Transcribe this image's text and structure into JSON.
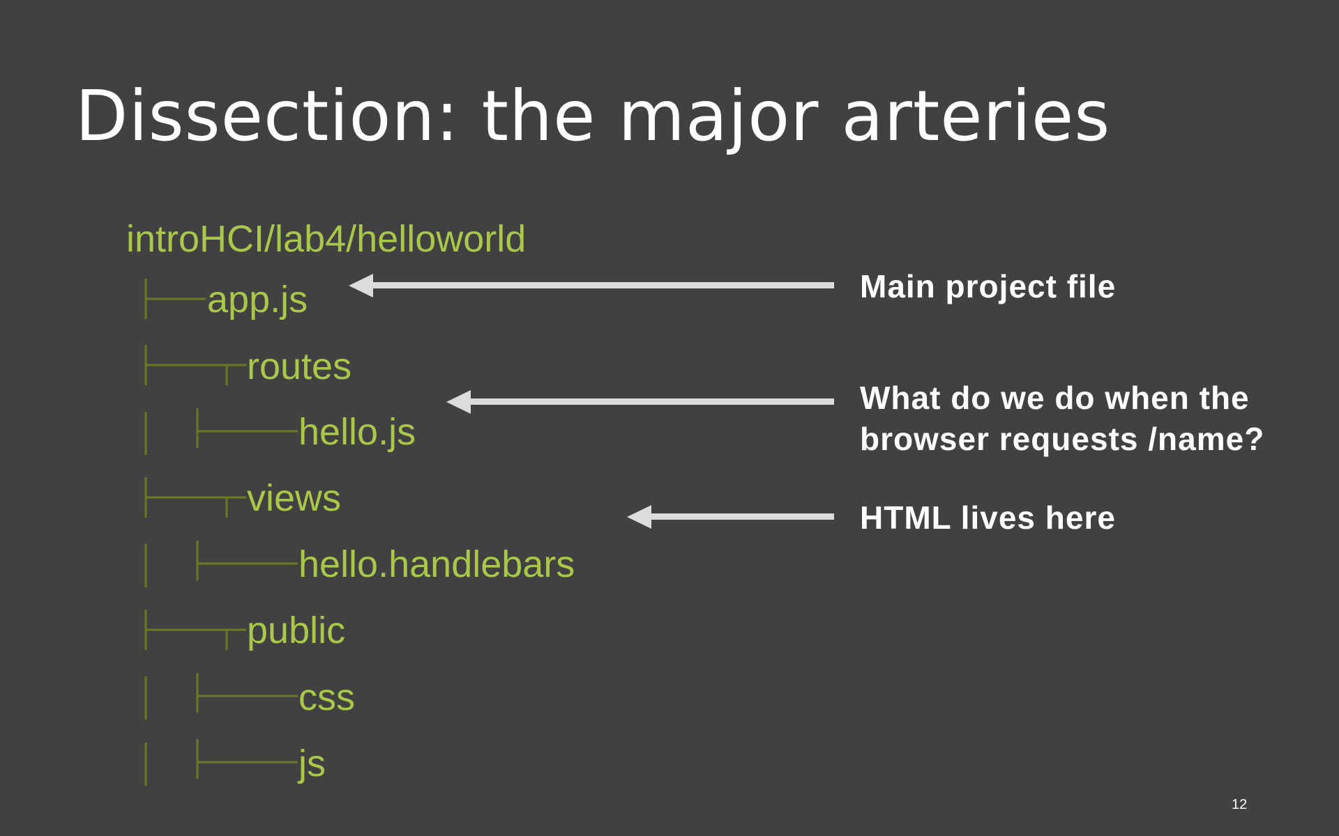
{
  "slide": {
    "title": "Dissection: the major arteries",
    "page_number": "12",
    "tree": {
      "root": "introHCI/lab4/helloworld",
      "items": [
        "app.js",
        "routes",
        "hello.js",
        "views",
        "hello.handlebars",
        "public",
        "css",
        "js"
      ]
    },
    "annotations": [
      "Main project file",
      "What do we do when the",
      "browser requests /name?",
      "HTML lives here"
    ],
    "colors": {
      "background": "#414141",
      "tree_text": "#a9c84a",
      "tree_lines": "#6b7a22",
      "arrows": "#dcdcdc"
    }
  }
}
